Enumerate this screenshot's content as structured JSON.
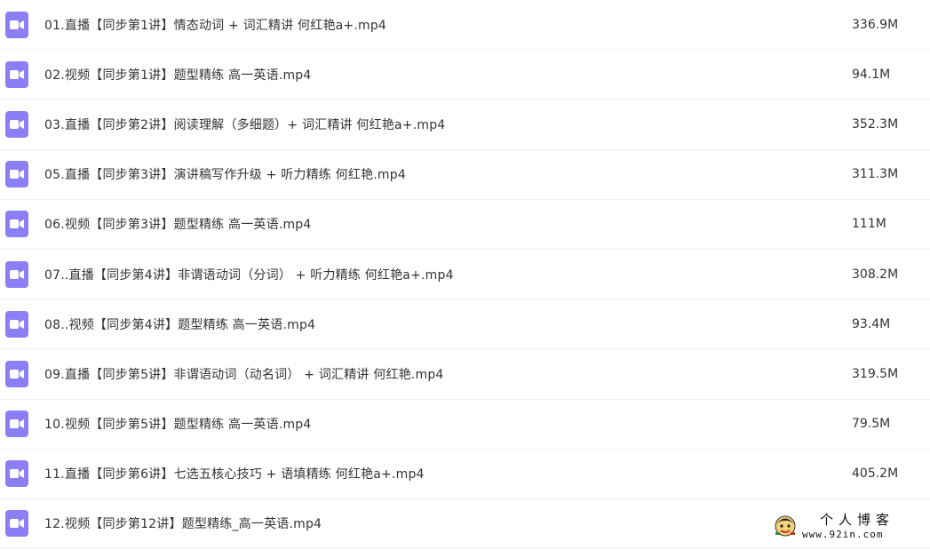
{
  "files": [
    {
      "name": "01.直播【同步第1讲】情态动词 + 词汇精讲 何红艳a+.mp4",
      "size": "336.9M",
      "icon": "video-file-icon"
    },
    {
      "name": "02.视频【同步第1讲】题型精练 高一英语.mp4",
      "size": "94.1M",
      "icon": "video-file-icon"
    },
    {
      "name": "03.直播【同步第2讲】阅读理解（多细题）+ 词汇精讲 何红艳a+.mp4",
      "size": "352.3M",
      "icon": "video-file-icon"
    },
    {
      "name": "05.直播【同步第3讲】演讲稿写作升级 + 听力精练 何红艳.mp4",
      "size": "311.3M",
      "icon": "video-file-icon"
    },
    {
      "name": "06.视频【同步第3讲】题型精练 高一英语.mp4",
      "size": "111M",
      "icon": "video-file-icon"
    },
    {
      "name": "07..直播【同步第4讲】非谓语动词（分词） + 听力精练 何红艳a+.mp4",
      "size": "308.2M",
      "icon": "video-file-icon"
    },
    {
      "name": "08..视频【同步第4讲】题型精练 高一英语.mp4",
      "size": "93.4M",
      "icon": "video-file-icon"
    },
    {
      "name": "09.直播【同步第5讲】非谓语动词（动名词） + 词汇精讲 何红艳.mp4",
      "size": "319.5M",
      "icon": "video-file-icon"
    },
    {
      "name": "10.视频【同步第5讲】题型精练 高一英语.mp4",
      "size": "79.5M",
      "icon": "video-file-icon"
    },
    {
      "name": "11.直播【同步第6讲】七选五核心技巧 + 语填精练 何红艳a+.mp4",
      "size": "405.2M",
      "icon": "video-file-icon"
    },
    {
      "name": "12.视频【同步第12讲】题型精练_高一英语.mp4",
      "size": "",
      "icon": "video-file-icon"
    }
  ],
  "watermark": {
    "title": "个人博客",
    "url": "www.92in.com"
  },
  "colors": {
    "icon_bg": "#8c7ff5",
    "text": "#333333",
    "divider": "#f0f0f3"
  }
}
